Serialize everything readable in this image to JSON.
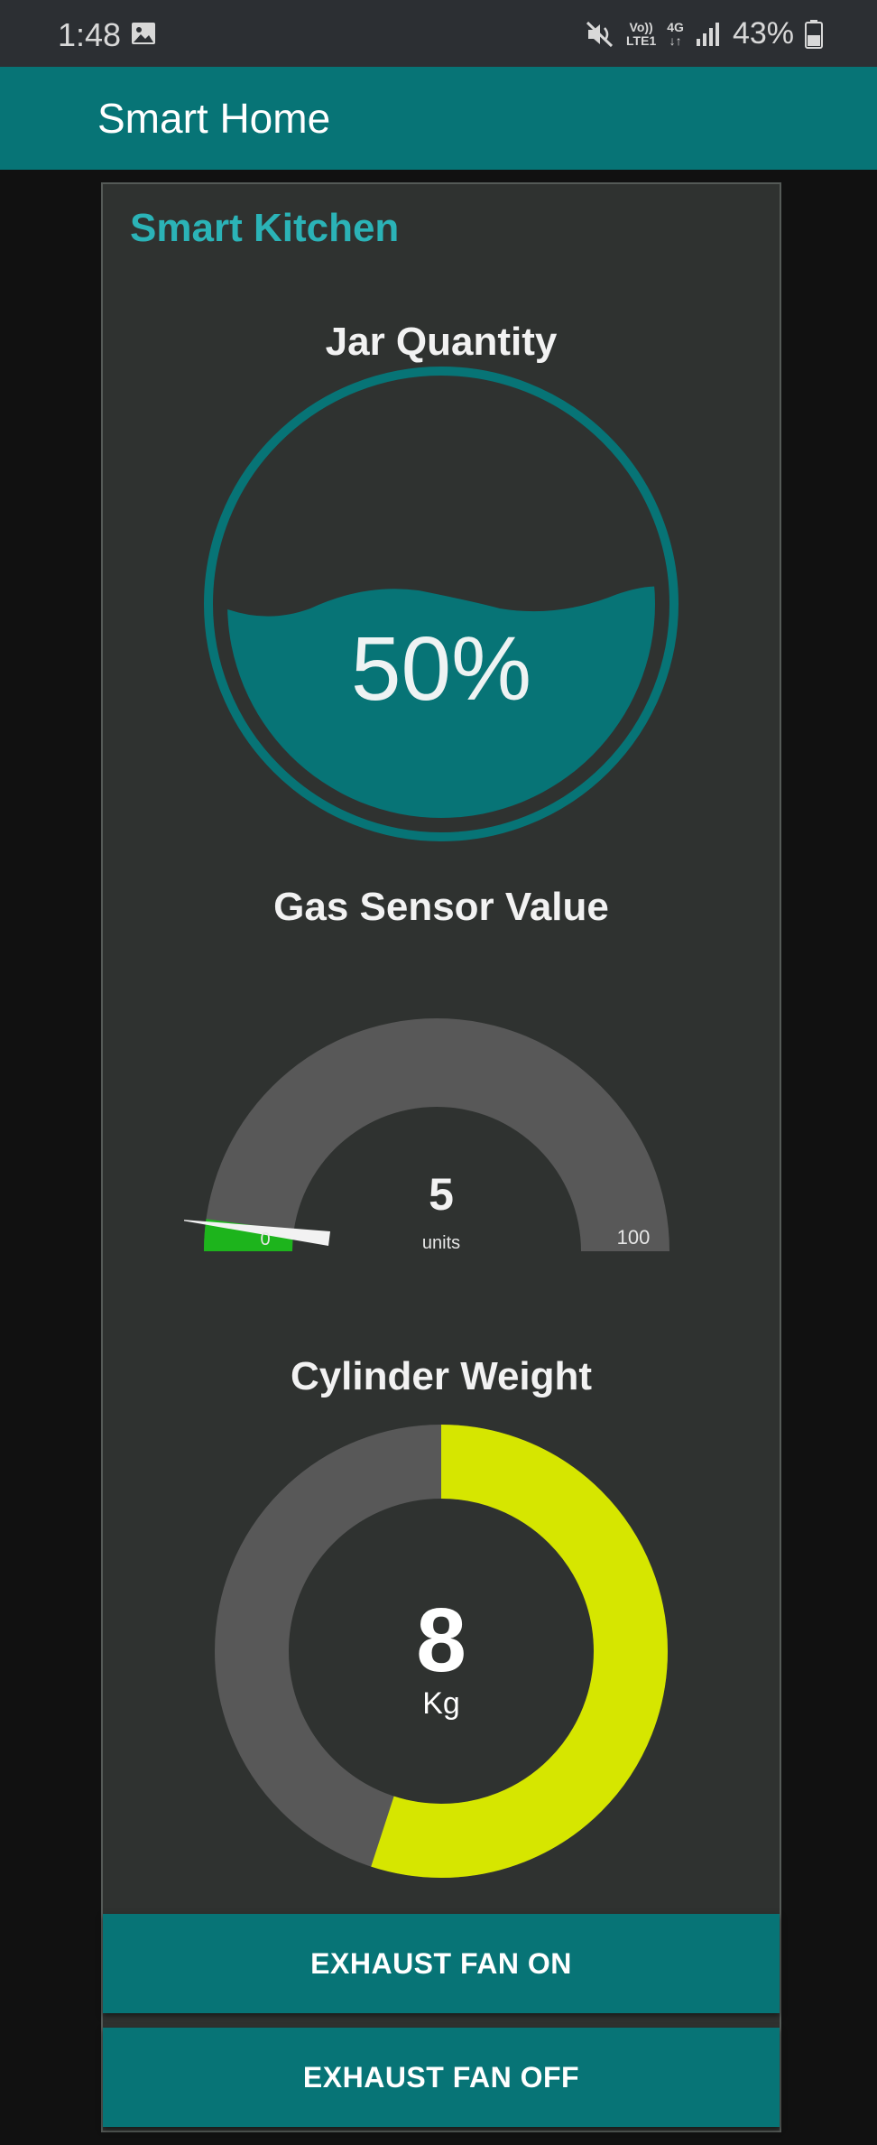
{
  "status_bar": {
    "time": "1:48",
    "volte": [
      "Vo))",
      "LTE1"
    ],
    "network": [
      "4G",
      "↓↑"
    ],
    "battery_percent": "43%",
    "icons": [
      "image-icon",
      "mute-icon",
      "signal-icon",
      "battery-icon"
    ]
  },
  "app_bar": {
    "title": "Smart Home",
    "color": "#077476"
  },
  "card": {
    "title": "Smart Kitchen",
    "jar": {
      "title": "Jar Quantity",
      "value_text": "50%",
      "level": 0.5,
      "color": "#077476"
    },
    "gas": {
      "title": "Gas Sensor Value",
      "value": "5",
      "units": "units",
      "min": "0",
      "max": "100",
      "fill_color": "#1db41c"
    },
    "cylinder": {
      "title": "Cylinder Weight",
      "value": "8",
      "unit": "Kg",
      "fraction": 0.55,
      "fill_color": "#d6e600"
    },
    "buttons": {
      "fan_on": "EXHAUST FAN ON",
      "fan_off": "EXHAUST FAN OFF"
    }
  }
}
